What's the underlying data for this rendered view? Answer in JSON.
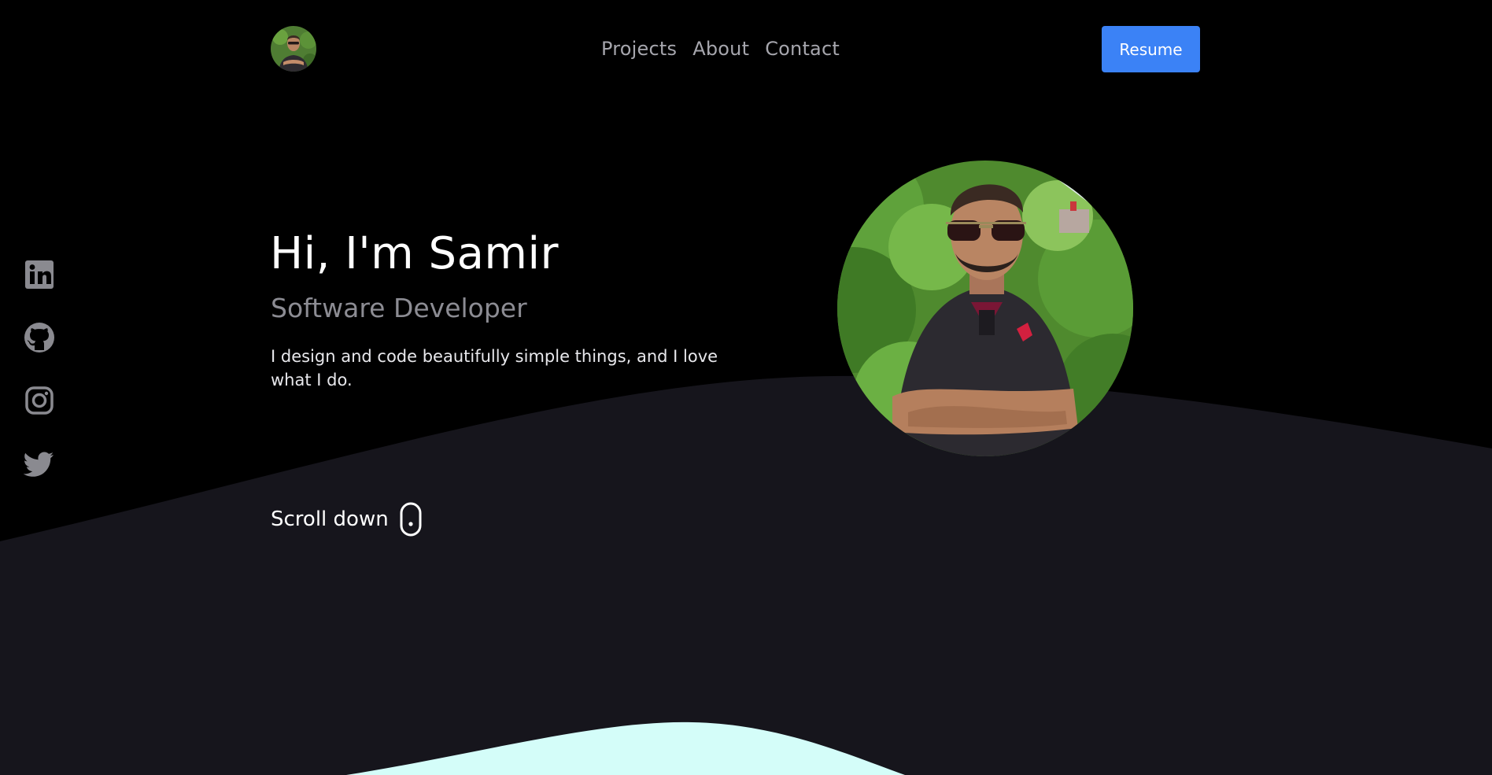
{
  "header": {
    "logo_alt": "Samir avatar",
    "nav": {
      "projects": "Projects",
      "about": "About",
      "contact": "Contact"
    },
    "resume_label": "Resume"
  },
  "socials": {
    "linkedin": "linkedin-icon",
    "github": "github-icon",
    "instagram": "instagram-icon",
    "twitter": "twitter-icon"
  },
  "hero": {
    "title": "Hi, I'm Samir",
    "subtitle": "Software Developer",
    "description": "I design and code beautifully simple things, and I love what I do.",
    "scroll_label": "Scroll down"
  },
  "colors": {
    "background": "#000000",
    "wave": "#16151c",
    "accent_wave": "#d4fdf9",
    "button": "#3b82f6",
    "nav_text": "#a6a6ad",
    "subtitle": "#8c8c93",
    "icon": "#8a8a90"
  }
}
